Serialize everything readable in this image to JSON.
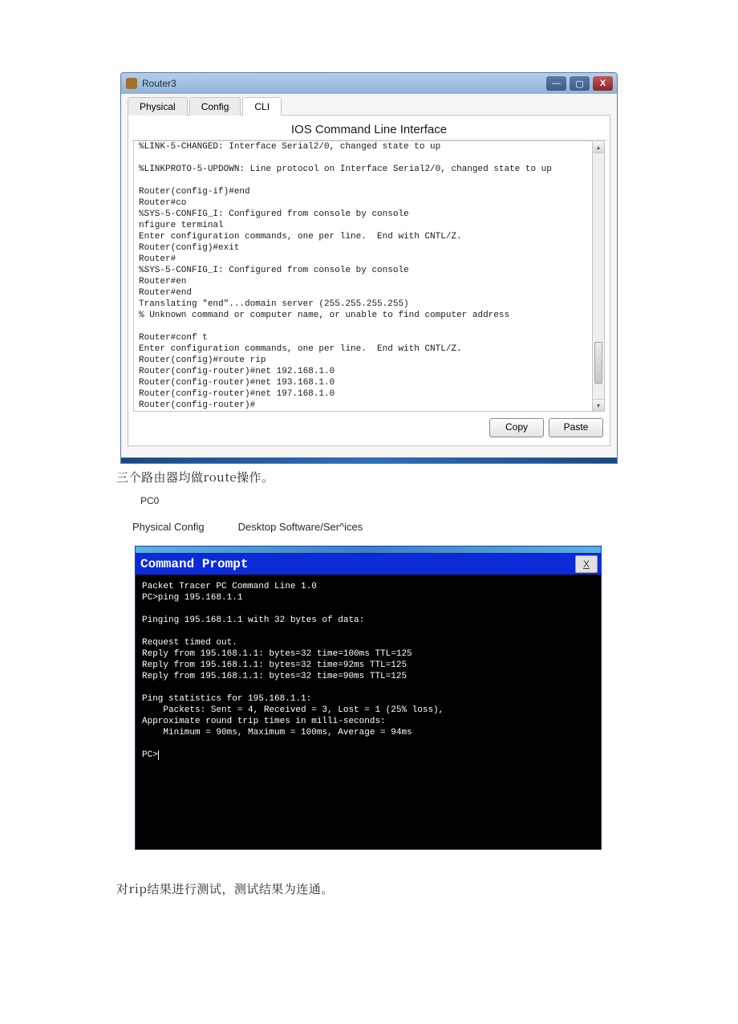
{
  "router_window": {
    "title": "Router3",
    "tabs": {
      "physical": "Physical",
      "config": "Config",
      "cli": "CLI"
    },
    "cli_header": "IOS Command Line Interface",
    "cli_output": "%LINK-5-CHANGED: Interface Serial2/0, changed state to up\n\n%LINKPROTO-5-UPDOWN: Line protocol on Interface Serial2/0, changed state to up\n\nRouter(config-if)#end\nRouter#co\n%SYS-5-CONFIG_I: Configured from console by console\nnfigure terminal\nEnter configuration commands, one per line.  End with CNTL/Z.\nRouter(config)#exit\nRouter#\n%SYS-5-CONFIG_I: Configured from console by console\nRouter#en\nRouter#end\nTranslating \"end\"...domain server (255.255.255.255)\n% Unknown command or computer name, or unable to find computer address\n\nRouter#conf t\nEnter configuration commands, one per line.  End with CNTL/Z.\nRouter(config)#route rip\nRouter(config-router)#net 192.168.1.0\nRouter(config-router)#net 193.168.1.0\nRouter(config-router)#net 197.168.1.0\nRouter(config-router)#",
    "buttons": {
      "copy": "Copy",
      "paste": "Paste"
    }
  },
  "text1": "三个路由器均做route操作。",
  "pc0": {
    "label": "PC0",
    "tabs": {
      "phys_config": "Physical Config",
      "desktop_sw": "Desktop Software/Ser^ices"
    }
  },
  "cmd_window": {
    "title": "Command Prompt",
    "close": "X",
    "output": "Packet Tracer PC Command Line 1.0\nPC>ping 195.168.1.1\n\nPinging 195.168.1.1 with 32 bytes of data:\n\nRequest timed out.\nReply from 195.168.1.1: bytes=32 time=100ms TTL=125\nReply from 195.168.1.1: bytes=32 time=92ms TTL=125\nReply from 195.168.1.1: bytes=32 time=90ms TTL=125\n\nPing statistics for 195.168.1.1:\n    Packets: Sent = 4, Received = 3, Lost = 1 (25% loss),\nApproximate round trip times in milli-seconds:\n    Minimum = 90ms, Maximum = 100ms, Average = 94ms\n\nPC>"
  },
  "text2": "对rip结果进行测试，测试结果为连通。"
}
